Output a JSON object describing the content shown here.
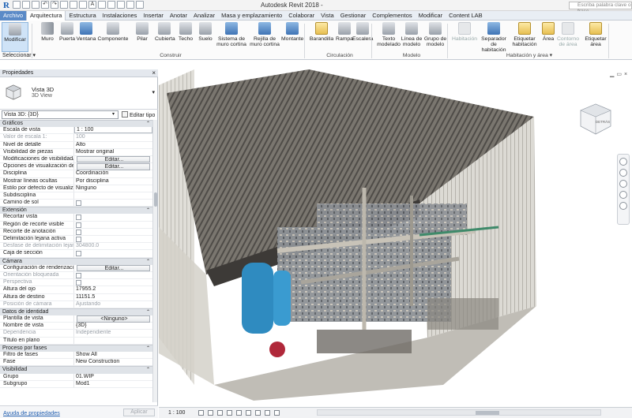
{
  "titlebar": {
    "app_title": "Autodesk Revit 2018 -",
    "doc_title": "",
    "search_placeholder": "Escriba palabra clave o frase"
  },
  "menu": {
    "tabs": [
      "Archivo",
      "Arquitectura",
      "Estructura",
      "Instalaciones",
      "Insertar",
      "Anotar",
      "Analizar",
      "Masa y emplazamiento",
      "Colaborar",
      "Vista",
      "Gestionar",
      "Complementos",
      "Modificar",
      "Content LAB"
    ],
    "active_index": 1
  },
  "ribbon": {
    "buttons": [
      {
        "label": "Modificar",
        "icon": "cursor-icon"
      },
      {
        "label": "Muro",
        "icon": "wall-icon"
      },
      {
        "label": "Puerta",
        "icon": "door-icon"
      },
      {
        "label": "Ventana",
        "icon": "window-icon"
      },
      {
        "label": "Componente",
        "icon": "component-icon"
      },
      {
        "label": "Pilar",
        "icon": "column-icon"
      },
      {
        "label": "Cubierta",
        "icon": "roof-icon"
      },
      {
        "label": "Techo",
        "icon": "ceiling-icon"
      },
      {
        "label": "Suelo",
        "icon": "floor-icon"
      },
      {
        "label": "Sistema de muro cortina",
        "icon": "curtain-system-icon"
      },
      {
        "label": "Rejilla de muro cortina",
        "icon": "curtain-grid-icon"
      },
      {
        "label": "Montante",
        "icon": "mullion-icon"
      },
      {
        "label": "Barandilla",
        "icon": "railing-icon"
      },
      {
        "label": "Rampa",
        "icon": "ramp-icon"
      },
      {
        "label": "Escalera",
        "icon": "stair-icon"
      },
      {
        "label": "Texto modelado",
        "icon": "model-text-icon"
      },
      {
        "label": "Línea de modelo",
        "icon": "model-line-icon"
      },
      {
        "label": "Grupo de modelo",
        "icon": "model-group-icon"
      },
      {
        "label": "Habitación",
        "icon": "room-icon"
      },
      {
        "label": "Separador de habitación",
        "icon": "room-separator-icon"
      },
      {
        "label": "Etiquetar habitación",
        "icon": "tag-room-icon"
      },
      {
        "label": "Área",
        "icon": "area-icon"
      },
      {
        "label": "Contorno de área",
        "icon": "area-boundary-icon"
      },
      {
        "label": "Etiquetar área",
        "icon": "tag-area-icon"
      }
    ],
    "groups": {
      "select": "Seleccionar ▾",
      "build": "Construir",
      "circulation": "Circulación",
      "model": "Modelo",
      "room_area": "Habitación y área ▾"
    }
  },
  "properties": {
    "header": "Propiedades",
    "type_name": "Vista 3D",
    "type_sub": "3D View",
    "instance": "Vista 3D: {3D}",
    "edit_type": "Editar tipo",
    "help": "Ayuda de propiedades",
    "apply": "Aplicar",
    "sections": [
      {
        "title": "Gráficos",
        "rows": [
          {
            "label": "Escala de vista",
            "value": "1 : 100",
            "kind": "input"
          },
          {
            "label": "Valor de escala    1:",
            "value": "100",
            "kind": "dim"
          },
          {
            "label": "Nivel de detalle",
            "value": "Alto",
            "kind": "text"
          },
          {
            "label": "Visibilidad de piezas",
            "value": "Mostrar original",
            "kind": "text"
          },
          {
            "label": "Modificaciones de visibilidad/...",
            "value": "Editar...",
            "kind": "btn"
          },
          {
            "label": "Opciones de visualización de g...",
            "value": "Editar...",
            "kind": "btn"
          },
          {
            "label": "Disciplina",
            "value": "Coordinación",
            "kind": "text"
          },
          {
            "label": "Mostrar líneas ocultas",
            "value": "Por disciplina",
            "kind": "text"
          },
          {
            "label": "Estilo por defecto de visualizac...",
            "value": "Ninguno",
            "kind": "text"
          },
          {
            "label": "Subdisciplina",
            "value": "",
            "kind": "text"
          },
          {
            "label": "Camino de sol",
            "value": "",
            "kind": "check"
          }
        ]
      },
      {
        "title": "Extensión",
        "rows": [
          {
            "label": "Recortar vista",
            "value": "",
            "kind": "check"
          },
          {
            "label": "Región de recorte visible",
            "value": "",
            "kind": "check"
          },
          {
            "label": "Recorte de anotación",
            "value": "",
            "kind": "check"
          },
          {
            "label": "Delimitación lejana activa",
            "value": "",
            "kind": "check"
          },
          {
            "label": "Desfase de delimitación lejano",
            "value": "304800.0",
            "kind": "dim"
          },
          {
            "label": "Caja de sección",
            "value": "",
            "kind": "check"
          }
        ]
      },
      {
        "title": "Cámara",
        "rows": [
          {
            "label": "Configuración de renderización",
            "value": "Editar...",
            "kind": "btn"
          },
          {
            "label": "Orientación bloqueada",
            "value": "",
            "kind": "dimcheck"
          },
          {
            "label": "Perspectiva",
            "value": "",
            "kind": "dimcheck"
          },
          {
            "label": "Altura del ojo",
            "value": "17955.2",
            "kind": "text"
          },
          {
            "label": "Altura de destino",
            "value": "11151.5",
            "kind": "text"
          },
          {
            "label": "Posición de cámara",
            "value": "Ajustando",
            "kind": "dim"
          }
        ]
      },
      {
        "title": "Datos de identidad",
        "rows": [
          {
            "label": "Plantilla de vista",
            "value": "<Ninguno>",
            "kind": "btn"
          },
          {
            "label": "Nombre de vista",
            "value": "{3D}",
            "kind": "text"
          },
          {
            "label": "Dependencia",
            "value": "Independiente",
            "kind": "dim"
          },
          {
            "label": "Título en plano",
            "value": "",
            "kind": "text"
          }
        ]
      },
      {
        "title": "Proceso por fases",
        "rows": [
          {
            "label": "Filtro de fases",
            "value": "Show All",
            "kind": "text"
          },
          {
            "label": "Fase",
            "value": "New Construction",
            "kind": "text"
          }
        ]
      },
      {
        "title": "Visibilidad",
        "rows": [
          {
            "label": "Grupo",
            "value": "01.WIP",
            "kind": "text"
          },
          {
            "label": "Subgrupo",
            "value": "Mod1",
            "kind": "text"
          }
        ]
      }
    ]
  },
  "viewport": {
    "scale": "1 : 100",
    "view_cube_label": "DETRÁS"
  },
  "colors": {
    "accent": "#5b8ac7",
    "roof": "#6e6a64",
    "wall": "#d8d6d0",
    "pipe": "#9aa0a6",
    "tank": "#2f8bc0"
  }
}
